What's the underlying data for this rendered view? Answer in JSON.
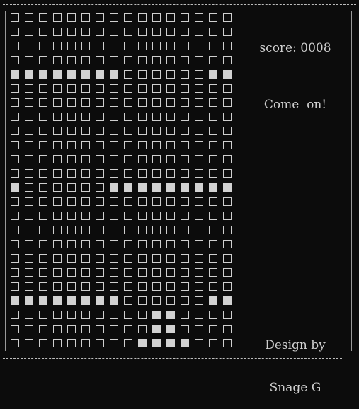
{
  "panel": {
    "score_label": "score:",
    "score_value": "0008",
    "message": "Come  on!",
    "credit_line1": "Design by",
    "credit_line2": "Snage G"
  },
  "board": {
    "cols": 16,
    "rows": 24,
    "filled": [
      [
        4,
        0
      ],
      [
        4,
        1
      ],
      [
        4,
        2
      ],
      [
        4,
        3
      ],
      [
        4,
        4
      ],
      [
        4,
        5
      ],
      [
        4,
        6
      ],
      [
        4,
        7
      ],
      [
        4,
        14
      ],
      [
        4,
        15
      ],
      [
        12,
        0
      ],
      [
        12,
        7
      ],
      [
        12,
        8
      ],
      [
        12,
        9
      ],
      [
        12,
        10
      ],
      [
        12,
        11
      ],
      [
        12,
        12
      ],
      [
        12,
        13
      ],
      [
        12,
        14
      ],
      [
        12,
        15
      ],
      [
        20,
        0
      ],
      [
        20,
        1
      ],
      [
        20,
        2
      ],
      [
        20,
        3
      ],
      [
        20,
        4
      ],
      [
        20,
        5
      ],
      [
        20,
        6
      ],
      [
        20,
        7
      ],
      [
        20,
        14
      ],
      [
        20,
        15
      ],
      [
        21,
        10
      ],
      [
        21,
        11
      ],
      [
        22,
        10
      ],
      [
        22,
        11
      ],
      [
        23,
        9
      ],
      [
        23,
        10
      ],
      [
        23,
        11
      ],
      [
        23,
        12
      ]
    ]
  }
}
